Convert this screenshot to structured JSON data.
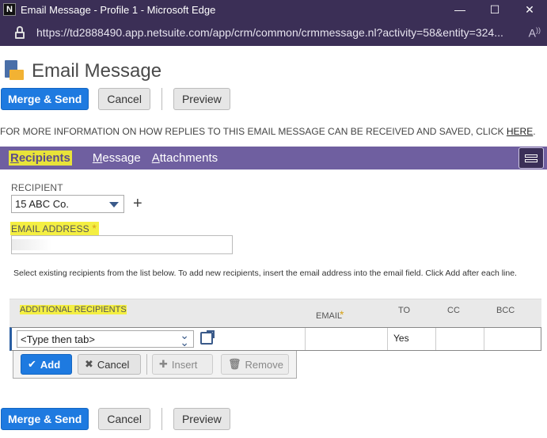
{
  "window": {
    "app_icon": "N",
    "title": "Email Message - Profile 1 - Microsoft Edge",
    "minimize_glyph": "—",
    "maximize_glyph": "☐",
    "close_glyph": "✕"
  },
  "address_bar": {
    "url": "https://td2888490.app.netsuite.com/app/crm/common/crmmessage.nl?activity=58&entity=324...",
    "read_aloud_glyph": "Aͅ"
  },
  "page": {
    "title": "Email Message",
    "info_text": "FOR MORE INFORMATION ON HOW REPLIES TO THIS EMAIL MESSAGE CAN BE RECEIVED AND SAVED, CLICK ",
    "info_link": "HERE",
    "info_end": "."
  },
  "top_buttons": {
    "merge_send": "Merge & Send",
    "cancel": "Cancel",
    "preview": "Preview"
  },
  "tabs": [
    {
      "label_first": "R",
      "label_rest": "ecipients",
      "active": true
    },
    {
      "label_first": "M",
      "label_rest": "essage",
      "active": false
    },
    {
      "label_first": "A",
      "label_rest": "ttachments",
      "active": false
    }
  ],
  "form": {
    "recipient_label": "RECIPIENT",
    "recipient_value": "15 ABC Co.",
    "email_label": "EMAIL ADDRESS",
    "required_mark": "*",
    "help_text": "Select existing recipients from the list below. To add new recipients, insert the email address into the email field. Click Add after each line."
  },
  "grid": {
    "headers": {
      "additional": "ADDITIONAL RECIPIENTS",
      "email": "EMAIL",
      "to": "TO",
      "cc": "CC",
      "bcc": "BCC"
    },
    "row": {
      "recipient_placeholder": "<Type then tab>",
      "to_value": "Yes"
    },
    "actions": {
      "add": "Add",
      "cancel": "Cancel",
      "insert": "Insert",
      "remove": "Remove"
    }
  },
  "bottom_buttons": {
    "merge_send": "Merge & Send",
    "cancel": "Cancel",
    "preview": "Preview"
  },
  "colors": {
    "titlebar": "#3b2f56",
    "tabbar": "#6f5fa0",
    "primary": "#1e7ae0",
    "highlight": "#f4ef42"
  }
}
